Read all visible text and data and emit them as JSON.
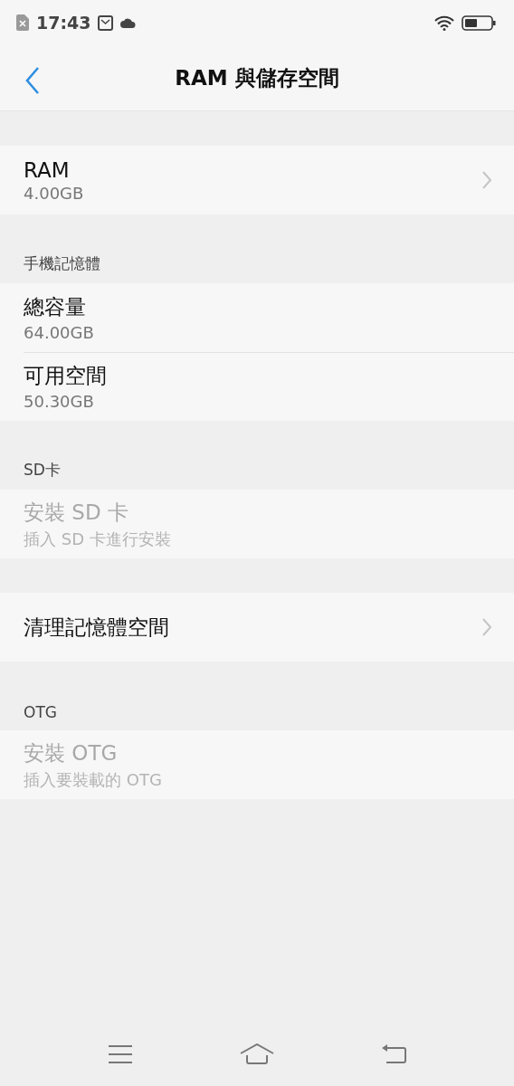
{
  "status_bar": {
    "time": "17:43"
  },
  "header": {
    "title": "RAM 與儲存空間"
  },
  "sections": [
    {
      "items": [
        {
          "title": "RAM",
          "subtitle": "4.00GB",
          "disabled": false,
          "chevron": true
        }
      ]
    },
    {
      "header": "手機記憶體",
      "items": [
        {
          "title": "總容量",
          "subtitle": "64.00GB",
          "disabled": false,
          "chevron": false
        },
        {
          "title": "可用空間",
          "subtitle": "50.30GB",
          "disabled": false,
          "chevron": false
        }
      ]
    },
    {
      "header": "SD卡",
      "items": [
        {
          "title": "安裝 SD 卡",
          "subtitle": "插入 SD 卡進行安裝",
          "disabled": true,
          "chevron": false
        }
      ]
    },
    {
      "items": [
        {
          "title": "清理記憶體空間",
          "disabled": false,
          "chevron": true
        }
      ]
    },
    {
      "header": "OTG",
      "items": [
        {
          "title": "安裝 OTG",
          "subtitle": "插入要裝載的 OTG",
          "disabled": true,
          "chevron": false
        }
      ]
    }
  ]
}
